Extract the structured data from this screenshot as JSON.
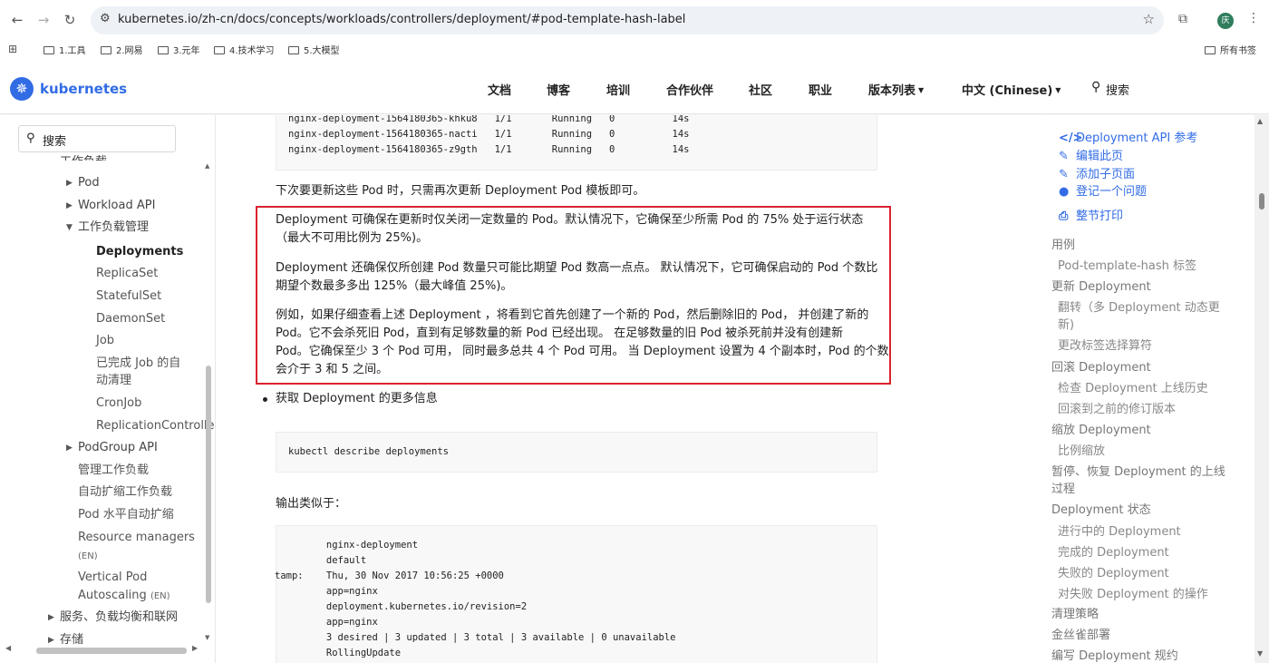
{
  "browser": {
    "url": "kubernetes.io/zh-cn/docs/concepts/workloads/controllers/deployment/#pod-template-hash-label",
    "avatar_text": "庆",
    "bookmarks": [
      "1.工具",
      "2.网易",
      "3.元年",
      "4.技术学习",
      "5.大模型"
    ],
    "all_bookmarks": "所有书签"
  },
  "site": {
    "brand": "kubernetes",
    "nav": [
      "文档",
      "博客",
      "培训",
      "合作伙伴",
      "社区",
      "职业",
      "版本列表",
      "中文 (Chinese)"
    ],
    "search_placeholder": "搜索"
  },
  "sidebar": {
    "search_placeholder": "搜索",
    "cut_label": "工作负载",
    "items": [
      "Pod",
      "Workload API",
      "工作负载管理",
      "Deployments",
      "ReplicaSet",
      "StatefulSet",
      "DaemonSet",
      "Job",
      "已完成 Job 的自",
      "动清理",
      "CronJob",
      "ReplicationControlle",
      "PodGroup API",
      "管理工作负载",
      "自动扩缩工作负载",
      "Pod 水平自动扩缩",
      "Resource managers",
      "(EN)",
      "Vertical Pod",
      "Autoscaling",
      "(EN)",
      "服务、负载均衡和联网",
      "存储"
    ]
  },
  "main": {
    "top_code": [
      "nginx-deployment-1564180365-khku8   1/1       Running   0          14s",
      "nginx-deployment-1564180365-nacti   1/1       Running   0          14s",
      "nginx-deployment-1564180365-z9gth   1/1       Running   0          14s"
    ],
    "intro": "下次要更新这些 Pod 时，只需再次更新 Deployment Pod 模板即可。",
    "box_p1": [
      "Deployment 可确保在更新时仅关闭一定数量的 Pod。默认情况下，它确保至少所需 Pod 的 75% 处于运行状态",
      "（最大不可用比例为 25%)。"
    ],
    "box_p2": [
      "Deployment 还确保仅所创建 Pod 数量只可能比期望 Pod 数高一点点。 默认情况下，它可确保启动的 Pod 个数比",
      "期望个数最多多出 125%（最大峰值 25%)。"
    ],
    "box_p3": [
      "例如，如果仔细查看上述 Deployment ，将看到它首先创建了一个新的 Pod，然后删除旧的 Pod， 并创建了新的",
      "Pod。它不会杀死旧 Pod，直到有足够数量的新 Pod 已经出现。 在足够数量的旧 Pod 被杀死前并没有创建新",
      "Pod。它确保至少 3 个 Pod 可用， 同时最多总共 4 个 Pod 可用。 当 Deployment 设置为 4 个副本时，Pod 的个数",
      "会介于 3 和 5 之间。"
    ],
    "bullet": "获取 Deployment 的更多信息",
    "describe_cmd": "kubectl describe deployments",
    "output_label": "输出类似于：",
    "output_code": [
      "         nginx-deployment",
      "         default",
      "tamp:    Thu, 30 Nov 2017 10:56:25 +0000",
      "         app=nginx",
      "         deployment.kubernetes.io/revision=2",
      "         app=nginx",
      "         3 desired | 3 updated | 3 total | 3 available | 0 unavailable",
      "         RollingUpdate"
    ]
  },
  "toc": {
    "actions": [
      "Deployment API 参考",
      "编辑此页",
      "添加子页面",
      "登记一个问题",
      "整节打印"
    ],
    "items": [
      "用例",
      "Pod-template-hash 标签",
      "更新 Deployment",
      "翻转（多 Deployment 动态更",
      "新)",
      "更改标签选择算符",
      "回滚 Deployment",
      "检查 Deployment 上线历史",
      "回滚到之前的修订版本",
      "缩放 Deployment",
      "比例缩放",
      "暂停、恢复 Deployment 的上线",
      "过程",
      "Deployment 状态",
      "进行中的 Deployment",
      "完成的 Deployment",
      "失败的 Deployment",
      "对失败 Deployment 的操作",
      "清理策略",
      "金丝雀部署",
      "编写 Deployment 规约"
    ]
  }
}
